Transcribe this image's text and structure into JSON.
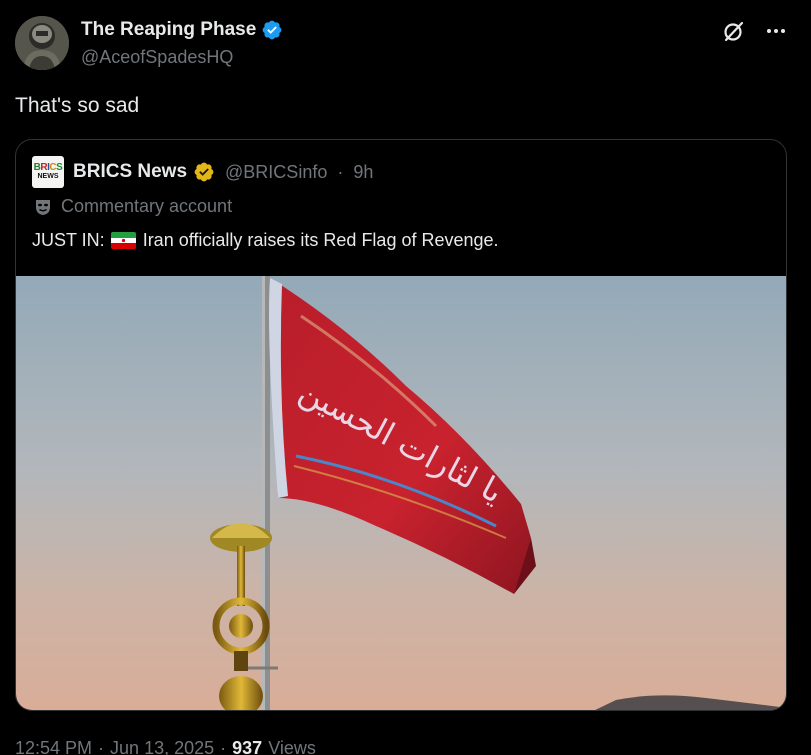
{
  "author": {
    "display_name": "The Reaping Phase",
    "handle": "@AceofSpadesHQ",
    "verified_color": "#1d9bf0"
  },
  "tweet": {
    "text": "That's so sad"
  },
  "quote": {
    "logo_line1": "BRICS",
    "logo_line2": "NEWS",
    "display_name": "BRICS News",
    "handle": "@BRICSinfo",
    "separator": "·",
    "time": "9h",
    "verified_color": "#e2b719",
    "commentary_label": "Commentary account",
    "text_prefix": "JUST IN:",
    "text_body": "Iran officially raises its Red Flag of Revenge.",
    "photo_flag_inscription": "يا لثارات الحسين",
    "photo_alt_icon": "red-flag-photo"
  },
  "footer": {
    "time": "12:54 PM",
    "dot1": "·",
    "date": "Jun 13, 2025",
    "dot2": "·",
    "views_count": "937",
    "views_label": "Views"
  },
  "icons": {
    "grok": "grok-icon",
    "more": "more-icon",
    "mask": "mask-icon"
  }
}
